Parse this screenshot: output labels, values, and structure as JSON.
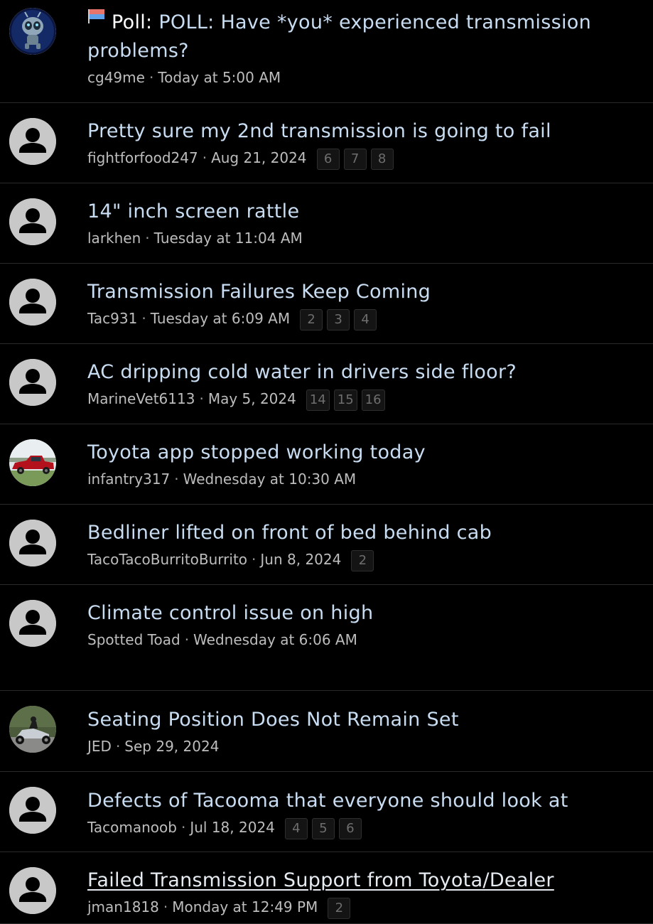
{
  "threads": [
    {
      "title": "POLL: Have *you* experienced transmission problems?",
      "prefix": "Poll:",
      "author": "cg49me",
      "date": "Today at 5:00 AM",
      "pages": [],
      "avatar": "invader-zim-avatar"
    },
    {
      "title": "Pretty sure my 2nd transmission is going to fail",
      "author": "fightforfood247",
      "date": "Aug 21, 2024",
      "pages": [
        "6",
        "7",
        "8"
      ],
      "avatar": "default-user-avatar"
    },
    {
      "title": "14\" inch screen rattle",
      "author": "larkhen",
      "date": "Tuesday at 11:04 AM",
      "pages": [],
      "avatar": "default-user-avatar"
    },
    {
      "title": "Transmission Failures Keep Coming",
      "author": "Tac931",
      "date": "Tuesday at 6:09 AM",
      "pages": [
        "2",
        "3",
        "4"
      ],
      "avatar": "default-user-avatar"
    },
    {
      "title": "AC dripping cold water in drivers side floor?",
      "author": "MarineVet6113",
      "date": "May 5, 2024",
      "pages": [
        "14",
        "15",
        "16"
      ],
      "avatar": "default-user-avatar"
    },
    {
      "title": "Toyota app stopped working today",
      "author": "infantry317",
      "date": "Wednesday at 10:30 AM",
      "pages": [],
      "avatar": "red-truck-avatar"
    },
    {
      "title": "Bedliner lifted on front of bed behind cab",
      "author": "TacoTacoBurritoBurrito",
      "date": "Jun 8, 2024",
      "pages": [
        "2"
      ],
      "avatar": "default-user-avatar"
    },
    {
      "title": "Climate control issue on high",
      "author": "Spotted Toad",
      "date": "Wednesday at 6:06 AM",
      "pages": [],
      "avatar": "default-user-avatar"
    },
    {
      "title": "Seating Position Does Not Remain Set",
      "author": "JED",
      "date": "Sep 29, 2024",
      "pages": [],
      "avatar": "motorcycle-avatar"
    },
    {
      "title": "Defects of Tacooma that everyone should look at",
      "author": "Tacomanoob",
      "date": "Jul 18, 2024",
      "pages": [
        "4",
        "5",
        "6"
      ],
      "avatar": "default-user-avatar"
    },
    {
      "title": "Failed Transmission Support from Toyota/Dealer",
      "author": "jman1818",
      "date": "Monday at 12:49 PM",
      "pages": [
        "2"
      ],
      "avatar": "default-user-avatar",
      "underlined": true
    }
  ],
  "separator": "·",
  "colors": {
    "background": "#000000",
    "title": "#c8dcf2",
    "meta": "#bdbdbd",
    "divider": "#2a2a2a",
    "default_avatar_bg": "#c8c8c8",
    "default_avatar_fg": "#000000"
  }
}
